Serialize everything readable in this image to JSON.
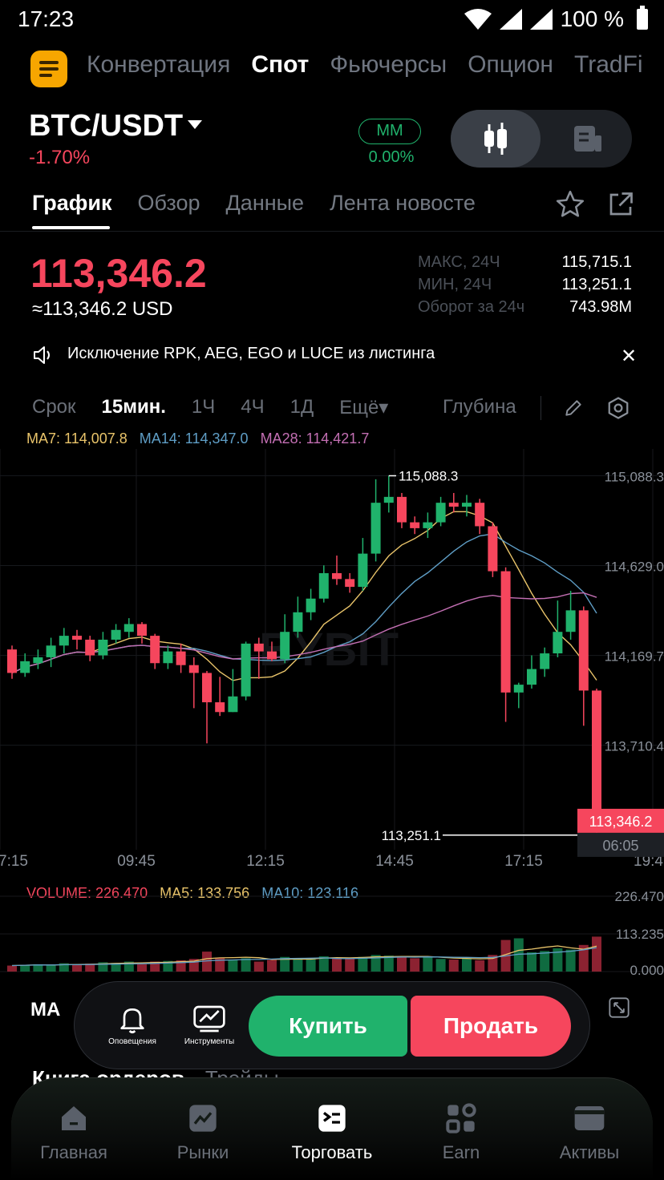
{
  "status": {
    "time": "17:23",
    "battery": "100 %"
  },
  "topnav": {
    "items": [
      "Конвертация",
      "Спот",
      "Фьючерсы",
      "Опцион",
      "TradFi"
    ],
    "active_index": 1
  },
  "pair": {
    "symbol": "BTC/USDT",
    "change": "-1.70%",
    "mm_label": "MM",
    "mm_value": "0.00%"
  },
  "tabs": {
    "items": [
      "График",
      "Обзор",
      "Данные",
      "Лента новосте"
    ],
    "active_index": 0
  },
  "price": {
    "last": "113,346.2",
    "usd": "≈113,346.2 USD",
    "stats": [
      {
        "label": "МАКС, 24Ч",
        "value": "115,715.1"
      },
      {
        "label": "МИН, 24Ч",
        "value": "113,251.1"
      },
      {
        "label": "Оборот за 24ч",
        "value": "743.98M"
      }
    ]
  },
  "announcement": {
    "text": "Исключение RPK, AEG, EGO и LUCE из листинга"
  },
  "chart_toolbar": {
    "items": [
      "Срок",
      "15мин.",
      "1Ч",
      "4Ч",
      "1Д",
      "Ещё▾"
    ],
    "active_index": 1,
    "depth": "Глубина"
  },
  "ma_legend": {
    "ma7": "MA7: 114,007.8",
    "ma14": "MA14: 114,347.0",
    "ma28": "MA28: 114,421.7"
  },
  "vol_legend": {
    "volume": "VOLUME: 226.470",
    "ma5": "MA5: 133.756",
    "ma10": "MA10: 123.116"
  },
  "colors": {
    "up": "#20b26c",
    "down": "#f6465d",
    "ma7": "#e9c46a",
    "ma14": "#5f9ec6",
    "ma28": "#c36fb3",
    "accent": "#f7a600"
  },
  "chart_data": {
    "type": "candlestick",
    "y_ticks": [
      "115,088.3",
      "114,629.0",
      "114,169.7",
      "113,710.4"
    ],
    "y_tick_values": [
      115088.3,
      114629.0,
      114169.7,
      113710.4
    ],
    "x_ticks": [
      "7:15",
      "09:45",
      "12:15",
      "14:45",
      "17:15",
      "19:4"
    ],
    "high_label": "115,088.3",
    "low_label": "113,251.1",
    "current_price": "113,346.2",
    "countdown": "06:05",
    "ylim": [
      113250,
      115090
    ],
    "candles": [
      [
        114200,
        114080,
        114220,
        114050
      ],
      [
        114080,
        114140,
        114180,
        114060
      ],
      [
        114130,
        114160,
        114200,
        114100
      ],
      [
        114160,
        114220,
        114260,
        114110
      ],
      [
        114220,
        114270,
        114310,
        114180
      ],
      [
        114270,
        114250,
        114300,
        114200
      ],
      [
        114250,
        114170,
        114270,
        114140
      ],
      [
        114170,
        114250,
        114290,
        114150
      ],
      [
        114250,
        114300,
        114330,
        114230
      ],
      [
        114290,
        114330,
        114360,
        114260
      ],
      [
        114330,
        114270,
        114340,
        114230
      ],
      [
        114270,
        114130,
        114280,
        114100
      ],
      [
        114130,
        114190,
        114220,
        114100
      ],
      [
        114190,
        114120,
        114230,
        114080
      ],
      [
        114120,
        114080,
        114160,
        113900
      ],
      [
        114080,
        113930,
        114090,
        113720
      ],
      [
        113930,
        113880,
        114060,
        113860
      ],
      [
        113880,
        113960,
        114100,
        113880
      ],
      [
        113960,
        114230,
        114240,
        113940
      ],
      [
        114230,
        114190,
        114260,
        114050
      ],
      [
        114190,
        114150,
        114240,
        114140
      ],
      [
        114150,
        114290,
        114380,
        114130
      ],
      [
        114290,
        114390,
        114470,
        114260
      ],
      [
        114390,
        114460,
        114510,
        114350
      ],
      [
        114460,
        114590,
        114630,
        114440
      ],
      [
        114590,
        114560,
        114680,
        114530
      ],
      [
        114560,
        114520,
        114590,
        114490
      ],
      [
        114520,
        114690,
        114770,
        114500
      ],
      [
        114690,
        114950,
        115070,
        114650
      ],
      [
        114950,
        114980,
        115088,
        114900
      ],
      [
        114980,
        114850,
        115000,
        114820
      ],
      [
        114850,
        114820,
        114880,
        114790
      ],
      [
        114820,
        114850,
        114900,
        114770
      ],
      [
        114850,
        114950,
        114980,
        114830
      ],
      [
        114950,
        114930,
        115000,
        114900
      ],
      [
        114930,
        114950,
        114990,
        114880
      ],
      [
        114950,
        114830,
        114970,
        114790
      ],
      [
        114830,
        114600,
        114850,
        114570
      ],
      [
        114600,
        113980,
        114620,
        113830
      ],
      [
        113980,
        114020,
        114030,
        113900
      ],
      [
        114020,
        114100,
        114170,
        114000
      ],
      [
        114100,
        114180,
        114210,
        114060
      ],
      [
        114180,
        114290,
        114450,
        114160
      ],
      [
        114290,
        114400,
        114500,
        114250
      ],
      [
        114400,
        113990,
        114420,
        113810
      ],
      [
        113990,
        113320,
        114000,
        113251
      ]
    ],
    "volume": [
      18,
      20,
      22,
      19,
      25,
      20,
      24,
      28,
      26,
      30,
      22,
      30,
      32,
      34,
      38,
      60,
      42,
      36,
      40,
      30,
      35,
      44,
      38,
      40,
      46,
      42,
      40,
      44,
      50,
      48,
      46,
      40,
      44,
      38,
      36,
      40,
      34,
      50,
      95,
      100,
      58,
      62,
      70,
      66,
      80,
      105
    ],
    "volume_y_ticks": [
      "226.470",
      "113.235",
      "0.000"
    ],
    "watermark": "BYBIT"
  },
  "action_bar": {
    "ma_label": "MA",
    "alerts_label": "Оповещения",
    "tools_label": "Инструменты",
    "buy": "Купить",
    "sell": "Продать"
  },
  "orderbook": {
    "tab1": "Книга ордеров",
    "tab2": "Трейды"
  },
  "bottom_nav": {
    "items": [
      "Главная",
      "Рынки",
      "Торговать",
      "Earn",
      "Активы"
    ],
    "active_index": 2
  }
}
